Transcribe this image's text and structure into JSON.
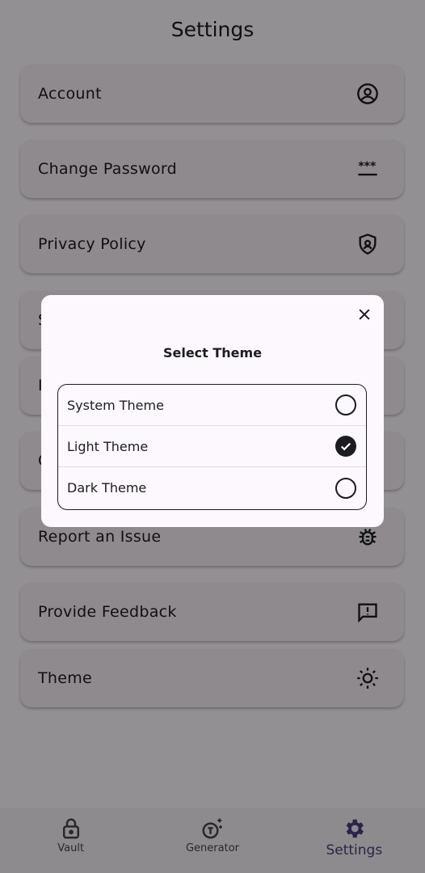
{
  "header": {
    "title": "Settings"
  },
  "settings_items": [
    {
      "label": "Account",
      "icon": "account-circle-icon"
    },
    {
      "label": "Change Password",
      "icon": "password-icon"
    },
    {
      "label": "Privacy Policy",
      "icon": "shield-icon"
    },
    {
      "label": "S",
      "icon": "hidden-icon"
    },
    {
      "label": "I",
      "icon": "hidden-icon"
    },
    {
      "label": "C",
      "icon": "hidden-icon"
    },
    {
      "label": "Report an Issue",
      "icon": "bug-icon"
    },
    {
      "label": "Provide Feedback",
      "icon": "feedback-icon"
    },
    {
      "label": "Theme",
      "icon": "sun-icon"
    }
  ],
  "dialog": {
    "title": "Select Theme",
    "close_icon": "close-icon",
    "options": [
      {
        "label": "System Theme",
        "selected": false
      },
      {
        "label": "Light Theme",
        "selected": true
      },
      {
        "label": "Dark Theme",
        "selected": false
      }
    ]
  },
  "navbar": {
    "items": [
      {
        "label": "Vault",
        "icon": "lock-icon",
        "active": false
      },
      {
        "label": "Generator",
        "icon": "generator-icon",
        "active": false
      },
      {
        "label": "Settings",
        "icon": "gear-icon",
        "active": true
      }
    ]
  },
  "colors": {
    "accent": "#4a3f7a",
    "surface": "#fdf8fd",
    "card": "#f4eef4",
    "scrim": "#8d8b8f"
  }
}
